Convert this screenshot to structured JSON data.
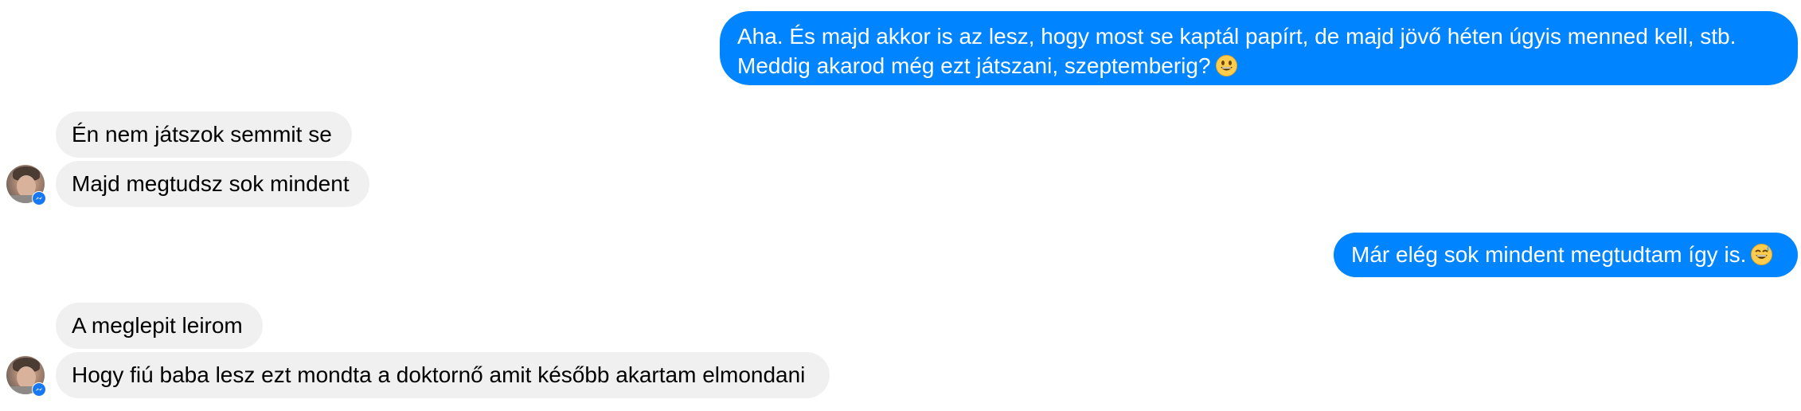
{
  "conversation": {
    "messages": [
      {
        "direction": "outgoing",
        "lines": [
          "Aha. És majd akkor is az lesz, hogy most se kaptál papírt, de majd jövő héten úgyis menned kell, stb.",
          "Meddig akarod még ezt játszani, szeptemberig?"
        ],
        "emoji": "grinning-emoji"
      },
      {
        "direction": "incoming",
        "text": "Én nem játszok semmit se"
      },
      {
        "direction": "incoming",
        "text": "Majd megtudsz sok mindent"
      },
      {
        "direction": "outgoing",
        "text": "Már elég sok mindent megtudtam így is.",
        "emoji": "grinning-sweat-emoji"
      },
      {
        "direction": "incoming",
        "text": "A meglepit leirom"
      },
      {
        "direction": "incoming",
        "text": "Hogy fiú baba lesz ezt mondta a doktornő amit később akartam elmondani"
      }
    ]
  },
  "colors": {
    "outgoing_bubble": "#0084ff",
    "incoming_bubble": "#f1f0f0",
    "messenger_badge": "#1877f2"
  }
}
